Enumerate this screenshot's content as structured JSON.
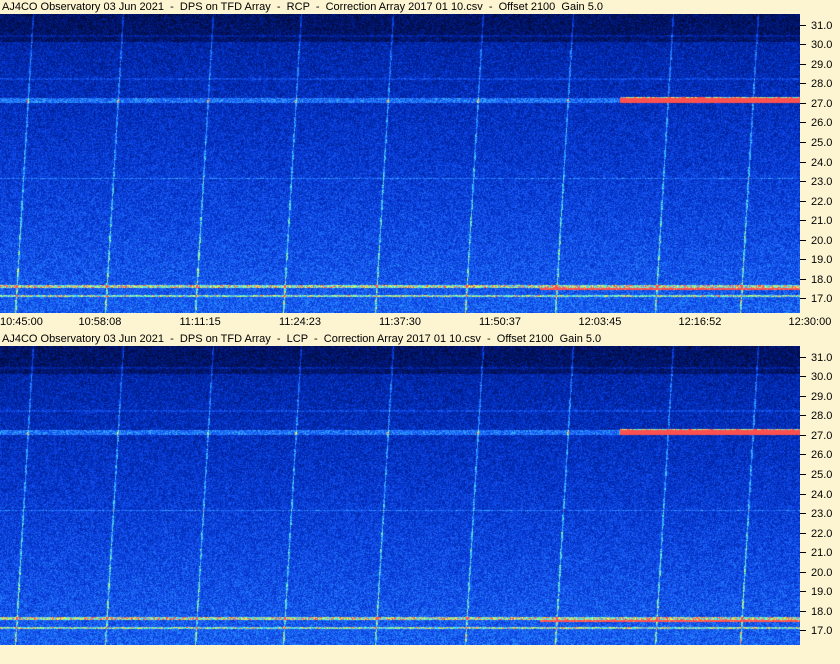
{
  "chart_data": [
    {
      "type": "heatmap",
      "title": "AJ4CO Observatory 03 Jun 2021  -  DPS on TFD Array  -  RCP  -  Correction Array 2017 01 10.csv  -  Offset 2100  Gain 5.0",
      "ylabels": [
        "31.0",
        "30.0",
        "29.0",
        "28.0",
        "27.0",
        "26.0",
        "25.0",
        "24.0",
        "23.0",
        "22.0",
        "21.0",
        "20.0",
        "19.0",
        "18.0",
        "17.0"
      ],
      "ylim": [
        16.3,
        31.6
      ],
      "xlabels": [
        "10:45:00",
        "10:58:08",
        "11:11:15",
        "11:24:23",
        "11:37:30",
        "11:50:37",
        "12:03:45",
        "12:16:52",
        "12:30:00"
      ],
      "colorscale": [
        "#000a30",
        "#001a80",
        "#0030c0",
        "#1a5cff",
        "#30b0ff",
        "#80ff80",
        "#ffff40",
        "#ff4040",
        "#ffffff"
      ]
    },
    {
      "type": "heatmap",
      "title": "AJ4CO Observatory 03 Jun 2021  -  DPS on TFD Array  -  LCP  -  Correction Array 2017 01 10.csv  -  Offset 2100  Gain 5.0",
      "ylabels": [
        "31.0",
        "30.0",
        "29.0",
        "28.0",
        "27.0",
        "26.0",
        "25.0",
        "24.0",
        "23.0",
        "22.0",
        "21.0",
        "20.0",
        "19.0",
        "18.0",
        "17.0"
      ],
      "ylim": [
        16.3,
        31.6
      ],
      "xlabels": [],
      "colorscale": [
        "#000a30",
        "#001a80",
        "#0030c0",
        "#1a5cff",
        "#30b0ff",
        "#80ff80",
        "#ffff40",
        "#ff4040",
        "#ffffff"
      ]
    }
  ]
}
